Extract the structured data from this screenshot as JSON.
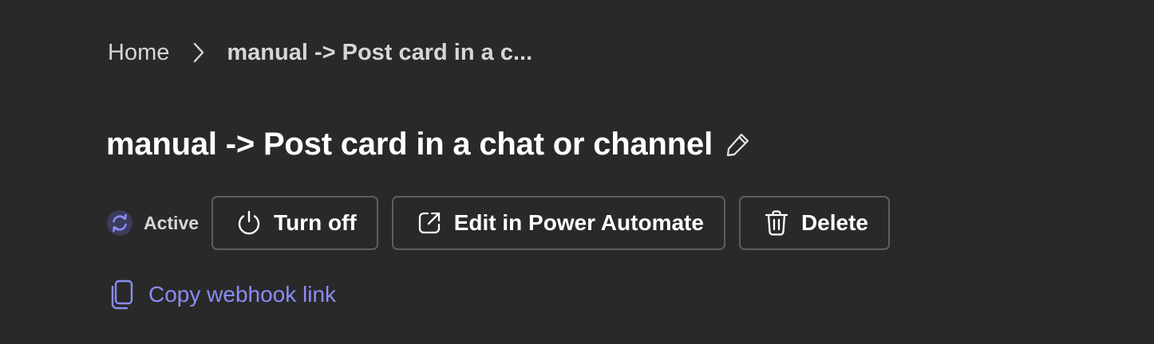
{
  "breadcrumb": {
    "home": "Home",
    "current": "manual -> Post card in a c..."
  },
  "page": {
    "title": "manual -> Post card in a chat or channel"
  },
  "status": {
    "label": "Active"
  },
  "actions": {
    "turn_off": "Turn off",
    "edit": "Edit in Power Automate",
    "delete": "Delete"
  },
  "webhook": {
    "copy_label": "Copy webhook link"
  },
  "icons": {
    "chevron": "chevron-right-icon",
    "edit_name": "pencil-icon",
    "status": "sync-icon",
    "turn_off": "power-icon",
    "edit": "open-external-icon",
    "delete": "trash-icon",
    "copy": "copy-icon"
  },
  "colors": {
    "background": "#292929",
    "accent": "#8b8cf5",
    "status_ring": "#7f85f5",
    "button_border": "#5e5e5e"
  }
}
